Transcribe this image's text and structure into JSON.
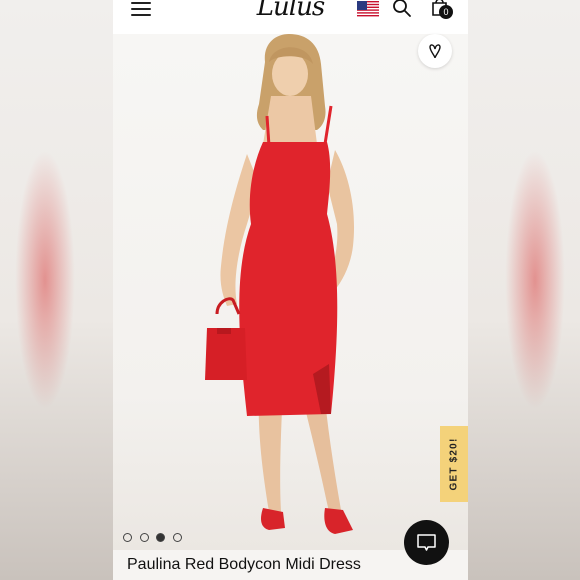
{
  "header": {
    "logo": "Lulus",
    "cart_count": "0",
    "icons": [
      "hamburger-menu-icon",
      "us-flag-icon",
      "search-icon",
      "shopping-bag-icon"
    ]
  },
  "product": {
    "title": "Paulina Red Bodycon Midi Dress",
    "image_description_icon": "red-dress-photo",
    "carousel": {
      "total": 4,
      "active_index": 2
    }
  },
  "actions": {
    "favorite_icon": "heart-icon",
    "promo_label": "GET $20!",
    "chat_icon": "chat-bubble-icon"
  },
  "colors": {
    "dress_red": "#e0242c",
    "promo_yellow": "#f4d27a",
    "chat_black": "#111111"
  }
}
